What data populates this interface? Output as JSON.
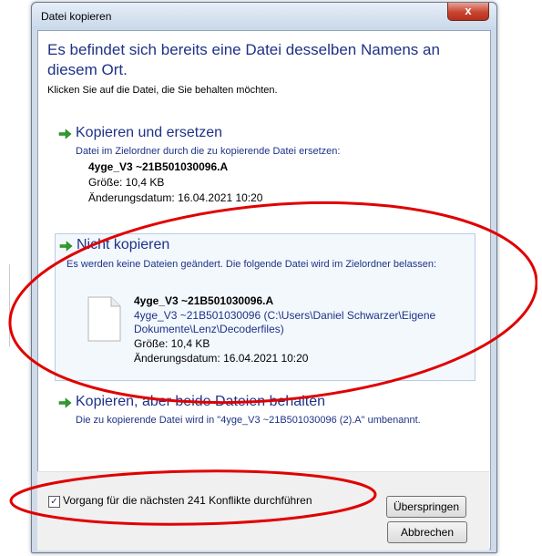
{
  "window": {
    "title": "Datei kopieren",
    "close_label": "x"
  },
  "dialog": {
    "heading": "Es befindet sich bereits eine Datei desselben Namens an diesem Ort.",
    "subtext": "Klicken Sie auf die Datei, die Sie behalten möchten."
  },
  "options": {
    "replace": {
      "title": "Kopieren und ersetzen",
      "desc": "Datei im Zielordner durch die zu kopierende Datei ersetzen:",
      "file_name": "4yge_V3 ~21B501030096.A",
      "size": "Größe: 10,4 KB",
      "modified": "Änderungsdatum: 16.04.2021 10:20"
    },
    "skip": {
      "title": "Nicht kopieren",
      "desc": "Es werden keine Dateien geändert. Die folgende Datei wird im Zielordner belassen:",
      "file_name": "4yge_V3 ~21B501030096.A",
      "path_line1": "4yge_V3 ~21B501030096 (C:\\Users\\Daniel Schwarzer\\Eigene",
      "path_line2": "Dokumente\\Lenz\\Decoderfiles)",
      "size": "Größe: 10,4 KB",
      "modified": "Änderungsdatum: 16.04.2021 10:20"
    },
    "keep_both": {
      "title": "Kopieren, aber beide Dateien behalten",
      "desc": "Die zu kopierende Datei wird in \"4yge_V3 ~21B501030096 (2).A\" umbenannt."
    }
  },
  "footer": {
    "checkbox_checked": true,
    "checkbox_label": "Vorgang für die nächsten 241 Konflikte durchführen",
    "skip_button": "Überspringen",
    "cancel_button": "Abbrechen"
  },
  "colors": {
    "link_blue": "#1e3287",
    "arrow_green": "#2e9d2a",
    "annotation_red": "#e00000"
  }
}
